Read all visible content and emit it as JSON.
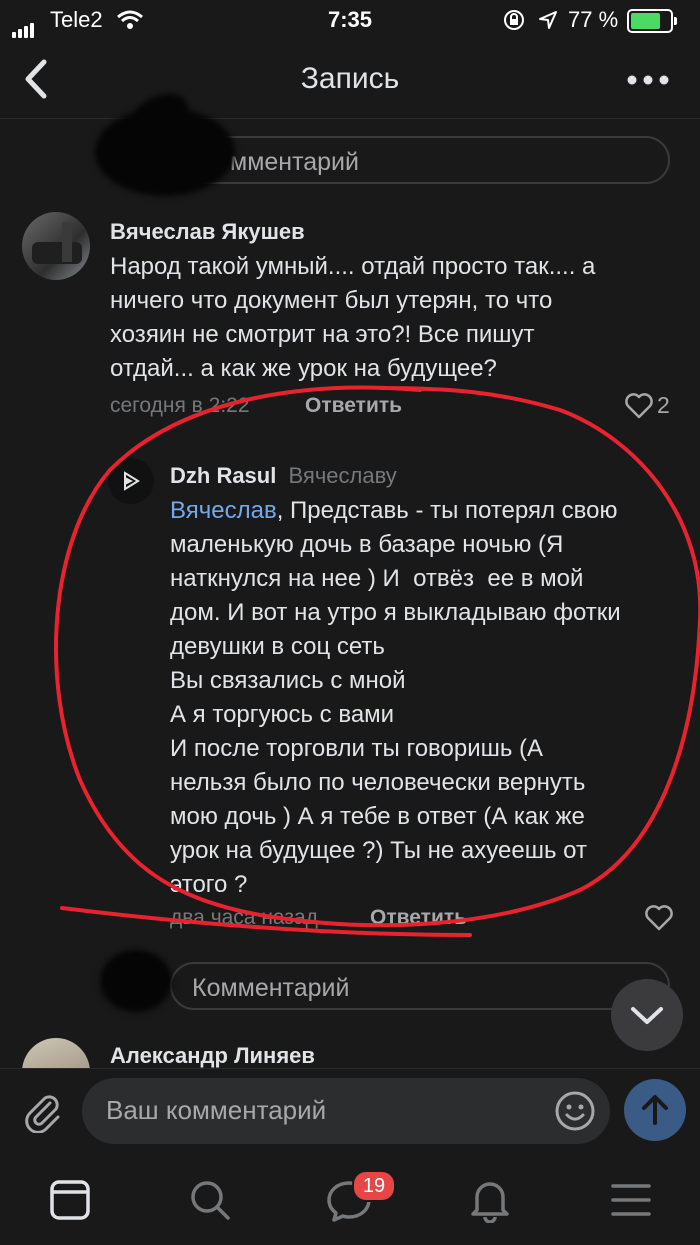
{
  "status_bar": {
    "carrier": "Tele2",
    "time": "7:35",
    "battery": "77 %",
    "battery_level": 0.77
  },
  "nav": {
    "title": "Запись",
    "back_icon": "chevron-left-icon",
    "more_icon": "more-horizontal-icon"
  },
  "top_comment_input": {
    "placeholder": "Комментарий",
    "visible_text": "мментарий"
  },
  "comments": [
    {
      "author": "Вячеслав Якушев",
      "text": "Народ такой умный.... отдай просто так.... а\nничего что документ был утерян, то что\nхозяин не смотрит на это?! Все пишут\nотдай... а как же урок на будущее?",
      "time": "сегодня в 2:22",
      "reply_label": "Ответить",
      "likes": "2"
    }
  ],
  "reply": {
    "author": "Dzh Rasul",
    "to": "Вячеславу",
    "mention": "Вячеслав",
    "text": ", Представь - ты потерял свою\nмаленькую дочь в базаре ночью (Я\nнаткнулся на нее ) И  отвёз  ее в мой\nдом. И вот на утро я выкладываю фотки\nдевушки в соц сеть\nВы связались с мной\nА я торгуюсь с вами\nИ после торговли ты говоришь (А\nнельзя было по человечески вернуть\nмою дочь ) А я тебе в ответ (А как же\nурок на будущее ?) Ты не ахуеешь от\nэтого ?",
    "time": "два часа назад",
    "reply_label": "Ответить"
  },
  "second_comment_input": {
    "placeholder": "Комментарий"
  },
  "next_comment": {
    "author": "Александр Линяев"
  },
  "composer": {
    "placeholder": "Ваш комментарий"
  },
  "tabbar": {
    "items": [
      "feed-icon",
      "search-icon",
      "messages-icon",
      "notifications-icon",
      "menu-icon"
    ],
    "messages_badge": "19"
  },
  "colors": {
    "background": "#19191a",
    "link": "#71aaeb",
    "badge": "#e64646",
    "send": "#3a5b85",
    "annotation": "#e8232f"
  }
}
